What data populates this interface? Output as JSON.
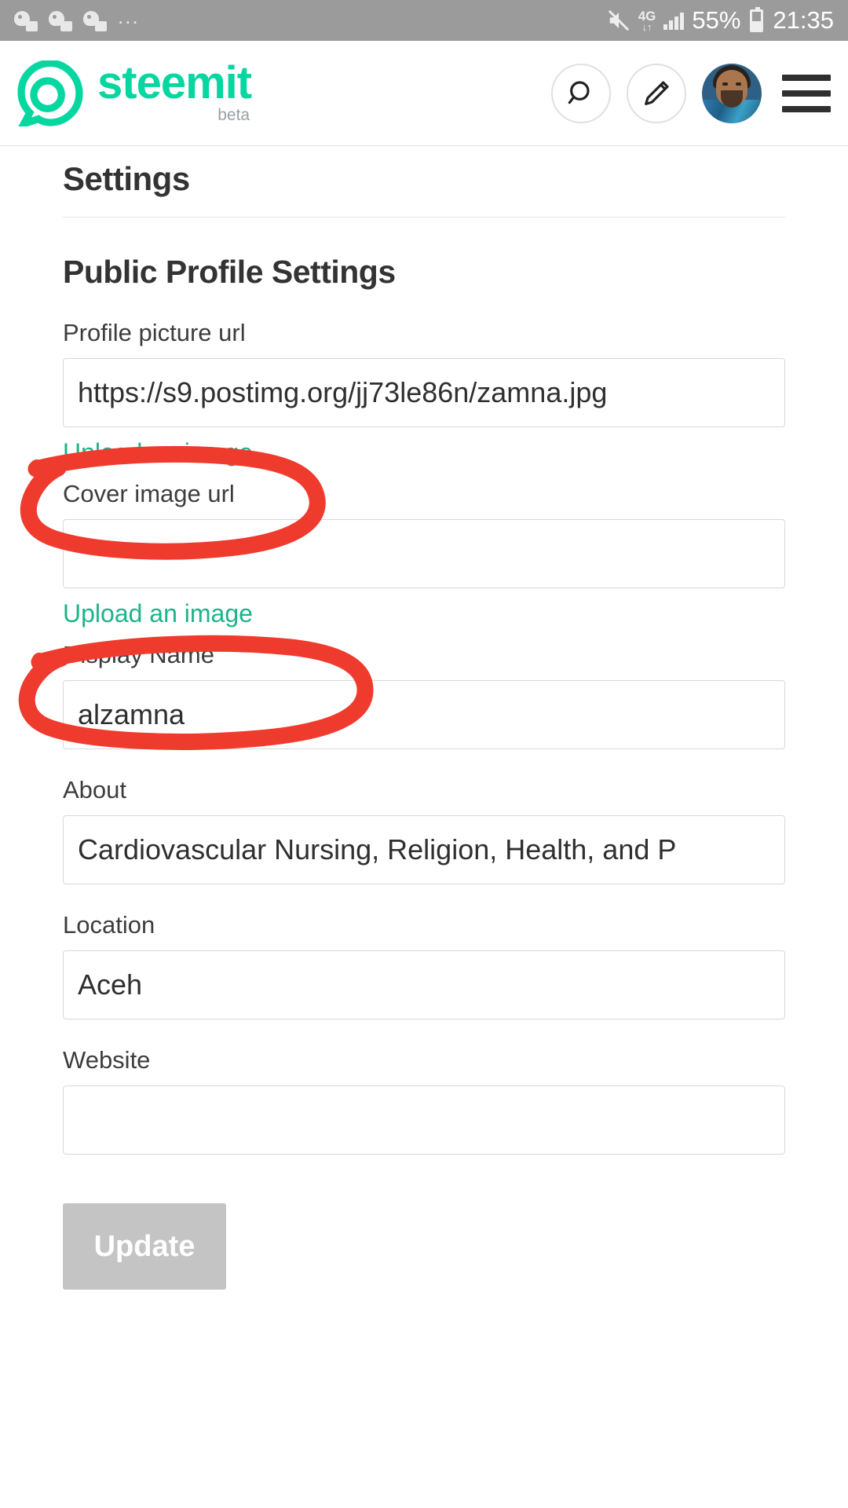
{
  "status_bar": {
    "notification_icons": [
      "messenger-notification-icon",
      "messenger-notification-icon",
      "messenger-notification-icon"
    ],
    "overflow_dots": "...",
    "mute_icon": "mute-icon",
    "network_type": "4G",
    "data_arrows": "↓↑",
    "signal_icon": "signal-bars-icon",
    "battery_percent": "55%",
    "battery_icon": "battery-icon",
    "clock": "21:35"
  },
  "header": {
    "logo_icon": "steemit-logo-icon",
    "brand_name": "steemit",
    "brand_tag": "beta",
    "search_icon": "search-icon",
    "compose_icon": "pencil-icon",
    "avatar": "user-avatar",
    "menu_icon": "hamburger-menu-icon"
  },
  "page": {
    "title": "Settings",
    "section_title": "Public Profile Settings",
    "fields": [
      {
        "label": "Profile picture url",
        "value": "https://s9.postimg.org/jj73le86n/zamna.jpg",
        "placeholder": ""
      },
      {
        "label": "Cover image url",
        "value": "",
        "placeholder": ""
      },
      {
        "label": "Display Name",
        "value": "alzamna",
        "placeholder": ""
      },
      {
        "label": "About",
        "value": "Cardiovascular Nursing, Religion, Health, and P",
        "placeholder": ""
      },
      {
        "label": "Location",
        "value": "Aceh",
        "placeholder": ""
      },
      {
        "label": "Website",
        "value": "",
        "placeholder": ""
      }
    ],
    "upload_link_label": "Upload an image",
    "update_button_label": "Update"
  },
  "colors": {
    "brand_green": "#06D6A0",
    "link_green": "#1DB489",
    "annotation_red": "#EF3B2D",
    "status_bar_gray": "#9b9b9b",
    "button_gray": "#c4c4c4"
  },
  "annotations": {
    "shape": "red-hand-drawn-ellipse",
    "count": 2,
    "targets": [
      "Upload an image (profile picture)",
      "Upload an image (cover image)"
    ]
  }
}
